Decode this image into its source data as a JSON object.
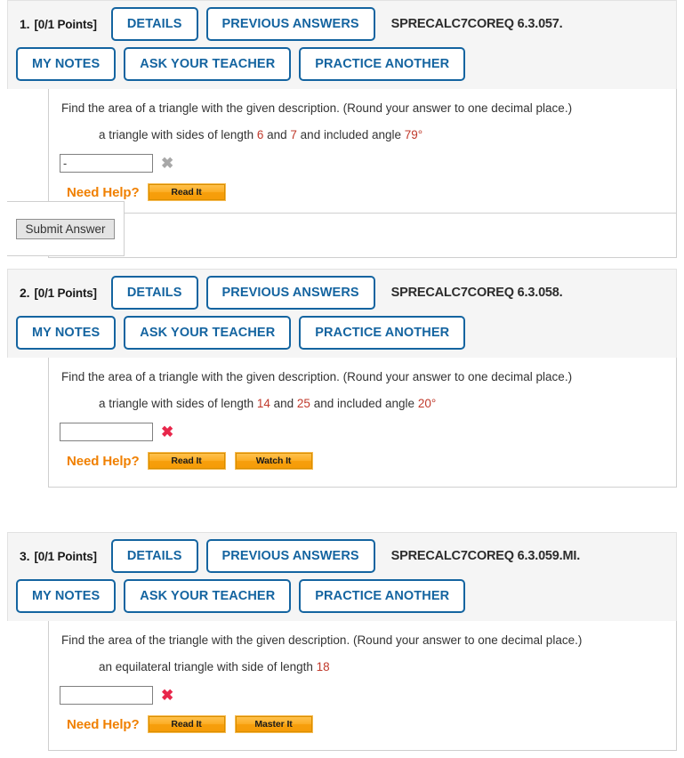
{
  "buttons": {
    "details": "DETAILS",
    "previous_answers": "PREVIOUS ANSWERS",
    "my_notes": "MY NOTES",
    "ask_your_teacher": "ASK YOUR TEACHER",
    "practice_another": "PRACTICE ANOTHER",
    "submit_answer": "Submit Answer",
    "read_it": "Read It",
    "watch_it": "Watch It",
    "master_it": "Master It"
  },
  "labels": {
    "need_help": "Need Help?",
    "points": "[0/1 Points]"
  },
  "marks": {
    "gray_x": "✖",
    "red_x": "✖"
  },
  "questions": [
    {
      "number": "1.",
      "points": "[0/1 Points]",
      "code": "SPRECALC7COREQ 6.3.057.",
      "prompt": "Find the area of a triangle with the given description. (Round your answer to one decimal place.)",
      "sub_prompt_parts": [
        {
          "text": "a triangle with sides of length ",
          "highlight": false
        },
        {
          "text": "6",
          "highlight": true
        },
        {
          "text": " and ",
          "highlight": false
        },
        {
          "text": "7",
          "highlight": true
        },
        {
          "text": " and included angle ",
          "highlight": false
        },
        {
          "text": "79°",
          "highlight": true
        }
      ],
      "sub_prompt": "a triangle with sides of length 6 and 7 and included angle 79°",
      "answer_value": "-",
      "answer_placeholder": "",
      "mark": "gray-x",
      "help_buttons": [
        "Read It"
      ],
      "has_submit": true
    },
    {
      "number": "2.",
      "points": "[0/1 Points]",
      "code": "SPRECALC7COREQ 6.3.058.",
      "prompt": "Find the area of a triangle with the given description. (Round your answer to one decimal place.)",
      "sub_prompt_parts": [
        {
          "text": "a triangle with sides of length ",
          "highlight": false
        },
        {
          "text": "14",
          "highlight": true
        },
        {
          "text": " and ",
          "highlight": false
        },
        {
          "text": "25",
          "highlight": true
        },
        {
          "text": " and included angle ",
          "highlight": false
        },
        {
          "text": "20°",
          "highlight": true
        }
      ],
      "sub_prompt": "a triangle with sides of length 14 and 25 and included angle 20°",
      "answer_value": "",
      "answer_placeholder": "",
      "mark": "red-x",
      "help_buttons": [
        "Read It",
        "Watch It"
      ],
      "has_submit": false
    },
    {
      "number": "3.",
      "points": "[0/1 Points]",
      "code": "SPRECALC7COREQ 6.3.059.MI.",
      "prompt": "Find the area of the triangle with the given description. (Round your answer to one decimal place.)",
      "sub_prompt_parts": [
        {
          "text": "an equilateral triangle with side of length ",
          "highlight": false
        },
        {
          "text": "18",
          "highlight": true
        }
      ],
      "sub_prompt": "an equilateral triangle with side of length 18",
      "answer_value": "",
      "answer_placeholder": "",
      "mark": "red-x",
      "help_buttons": [
        "Read It",
        "Master It"
      ],
      "has_submit": false
    }
  ],
  "colors": {
    "accent_blue": "#1464a0",
    "orange": "#f08000",
    "number_red": "#c0392b",
    "mark_red": "#e8274b",
    "mark_gray": "#a8a8a8",
    "header_bg": "#f5f5f5"
  }
}
